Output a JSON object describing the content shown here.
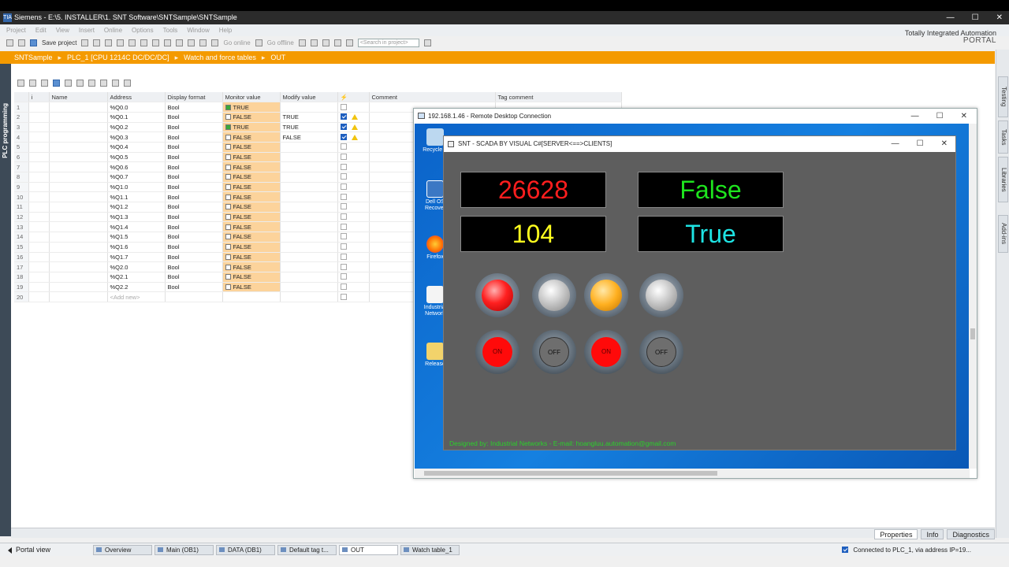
{
  "app": {
    "title": "Siemens  -  E:\\5. INSTALLER\\1. SNT Software\\SNTSample\\SNTSample",
    "brand_line1": "Totally Integrated Automation",
    "brand_line2": "PORTAL",
    "menu": [
      "Project",
      "Edit",
      "View",
      "Insert",
      "Online",
      "Options",
      "Tools",
      "Window",
      "Help"
    ],
    "toolbar": {
      "save_label": "Save project",
      "go_online": "Go online",
      "go_offline": "Go offline",
      "search_placeholder": "<Search in project>"
    },
    "breadcrumb": [
      "SNTSample",
      "PLC_1 [CPU 1214C DC/DC/DC]",
      "Watch and force tables",
      "OUT"
    ],
    "left_tab": "PLC programming",
    "right_tabs": [
      "Testing",
      "Tasks",
      "Libraries",
      "Add-ins"
    ]
  },
  "watch_table": {
    "headers": [
      "i",
      "Name",
      "Address",
      "Display format",
      "Monitor value",
      "Modify value",
      "",
      "Comment",
      "Tag comment"
    ],
    "rows": [
      {
        "num": "1",
        "address": "%Q0.0",
        "format": "Bool",
        "monitor": "TRUE",
        "monitor_on": true,
        "modify": "",
        "checked": false,
        "warn": false
      },
      {
        "num": "2",
        "address": "%Q0.1",
        "format": "Bool",
        "monitor": "FALSE",
        "monitor_on": false,
        "modify": "TRUE",
        "checked": true,
        "warn": true
      },
      {
        "num": "3",
        "address": "%Q0.2",
        "format": "Bool",
        "monitor": "TRUE",
        "monitor_on": true,
        "modify": "TRUE",
        "checked": true,
        "warn": true
      },
      {
        "num": "4",
        "address": "%Q0.3",
        "format": "Bool",
        "monitor": "FALSE",
        "monitor_on": false,
        "modify": "FALSE",
        "checked": true,
        "warn": true
      },
      {
        "num": "5",
        "address": "%Q0.4",
        "format": "Bool",
        "monitor": "FALSE",
        "monitor_on": false,
        "modify": "",
        "checked": false,
        "warn": false
      },
      {
        "num": "6",
        "address": "%Q0.5",
        "format": "Bool",
        "monitor": "FALSE",
        "monitor_on": false,
        "modify": "",
        "checked": false,
        "warn": false
      },
      {
        "num": "7",
        "address": "%Q0.6",
        "format": "Bool",
        "monitor": "FALSE",
        "monitor_on": false,
        "modify": "",
        "checked": false,
        "warn": false
      },
      {
        "num": "8",
        "address": "%Q0.7",
        "format": "Bool",
        "monitor": "FALSE",
        "monitor_on": false,
        "modify": "",
        "checked": false,
        "warn": false
      },
      {
        "num": "9",
        "address": "%Q1.0",
        "format": "Bool",
        "monitor": "FALSE",
        "monitor_on": false,
        "modify": "",
        "checked": false,
        "warn": false
      },
      {
        "num": "10",
        "address": "%Q1.1",
        "format": "Bool",
        "monitor": "FALSE",
        "monitor_on": false,
        "modify": "",
        "checked": false,
        "warn": false
      },
      {
        "num": "11",
        "address": "%Q1.2",
        "format": "Bool",
        "monitor": "FALSE",
        "monitor_on": false,
        "modify": "",
        "checked": false,
        "warn": false
      },
      {
        "num": "12",
        "address": "%Q1.3",
        "format": "Bool",
        "monitor": "FALSE",
        "monitor_on": false,
        "modify": "",
        "checked": false,
        "warn": false
      },
      {
        "num": "13",
        "address": "%Q1.4",
        "format": "Bool",
        "monitor": "FALSE",
        "monitor_on": false,
        "modify": "",
        "checked": false,
        "warn": false
      },
      {
        "num": "14",
        "address": "%Q1.5",
        "format": "Bool",
        "monitor": "FALSE",
        "monitor_on": false,
        "modify": "",
        "checked": false,
        "warn": false
      },
      {
        "num": "15",
        "address": "%Q1.6",
        "format": "Bool",
        "monitor": "FALSE",
        "monitor_on": false,
        "modify": "",
        "checked": false,
        "warn": false
      },
      {
        "num": "16",
        "address": "%Q1.7",
        "format": "Bool",
        "monitor": "FALSE",
        "monitor_on": false,
        "modify": "",
        "checked": false,
        "warn": false
      },
      {
        "num": "17",
        "address": "%Q2.0",
        "format": "Bool",
        "monitor": "FALSE",
        "monitor_on": false,
        "modify": "",
        "checked": false,
        "warn": false
      },
      {
        "num": "18",
        "address": "%Q2.1",
        "format": "Bool",
        "monitor": "FALSE",
        "monitor_on": false,
        "modify": "",
        "checked": false,
        "warn": false
      },
      {
        "num": "19",
        "address": "%Q2.2",
        "format": "Bool",
        "monitor": "FALSE",
        "monitor_on": false,
        "modify": "",
        "checked": false,
        "warn": false
      }
    ],
    "add_row": {
      "num": "20",
      "address": "<Add new>"
    }
  },
  "rdp": {
    "title": "192.168.1.46 - Remote Desktop Connection",
    "desktop_icons": [
      "Recycle B",
      "Dell OS Recover",
      "Firefox",
      "Industrial Network",
      "Release"
    ]
  },
  "scada": {
    "title": "SNT - SCADA BY VISUAL C#[SERVER<==>CLIENTS]",
    "displays": [
      {
        "value": "26628",
        "color": "#ff1e1e"
      },
      {
        "value": "False",
        "color": "#1ee31e"
      },
      {
        "value": "104",
        "color": "#ffff1e"
      },
      {
        "value": "True",
        "color": "#1ee3e3"
      }
    ],
    "lamps": [
      "red",
      "gray",
      "amber",
      "gray"
    ],
    "buttons": [
      {
        "label": "ON",
        "state": "on"
      },
      {
        "label": "OFF",
        "state": "off"
      },
      {
        "label": "ON",
        "state": "on"
      },
      {
        "label": "OFF",
        "state": "off"
      }
    ],
    "footer": "Designed by: Industrial Networks - E-mail: hoangluu.automation@gmail.com"
  },
  "bottom_tabs": [
    "Properties",
    "Info",
    "Diagnostics"
  ],
  "taskbar": {
    "portal_view": "Portal view",
    "items": [
      "Overview",
      "Main (OB1)",
      "DATA (DB1)",
      "Default tag t...",
      "OUT",
      "Watch table_1"
    ],
    "active_item": "OUT",
    "status": "Connected to PLC_1, via address IP=19..."
  }
}
